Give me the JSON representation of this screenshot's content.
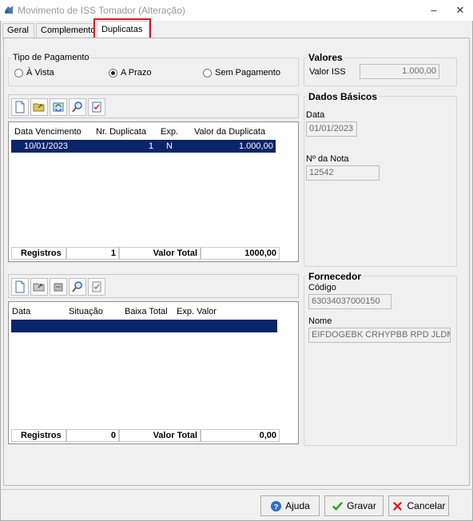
{
  "window": {
    "title": "Movimento de ISS Tomador (Alteração)",
    "controls": {
      "minimize": "–",
      "close": "✕"
    }
  },
  "tabs": [
    {
      "label": "Geral"
    },
    {
      "label": "Complemento"
    },
    {
      "label": "Duplicatas",
      "active": true
    }
  ],
  "tipo_pagamento": {
    "title": "Tipo de Pagamento",
    "options": [
      {
        "label": "À Vista",
        "selected": false
      },
      {
        "label": "A Prazo",
        "selected": true
      },
      {
        "label": "Sem Pagamento",
        "selected": false
      }
    ]
  },
  "valores": {
    "title": "Valores",
    "iss_label": "Valor ISS",
    "iss_value": "1.000,00"
  },
  "dados_basicos": {
    "title": "Dados Básicos",
    "data_label": "Data",
    "data_value": "01/01/2023",
    "nota_label": "Nº da Nota",
    "nota_value": "12542"
  },
  "fornecedor": {
    "title": "Fornecedor",
    "codigo_label": "Código",
    "codigo_value": "63034037000150",
    "nome_label": "Nome",
    "nome_value": "EIFDOGEBK CRHYPBB RPD JLDM"
  },
  "duplicatas_grid": {
    "columns": [
      "Data Vencimento",
      "Nr. Duplicata",
      "Exp.",
      "Valor da Duplicata"
    ],
    "rows": [
      {
        "data": "10/01/2023",
        "nr": "1",
        "exp": "N",
        "valor": "1.000,00"
      }
    ],
    "footer": {
      "registros_label": "Registros",
      "registros": "1",
      "total_label": "Valor Total",
      "total": "1000,00"
    }
  },
  "baixas_grid": {
    "columns": [
      "Data",
      "Situação",
      "Baixa Total",
      "Exp. Valor"
    ],
    "footer": {
      "registros_label": "Registros",
      "registros": "0",
      "total_label": "Valor Total",
      "total": "0,00"
    }
  },
  "buttons": {
    "ajuda": "Ajuda",
    "gravar": "Gravar",
    "cancelar": "Cancelar"
  },
  "colors": {
    "selection": "#0a246a",
    "tab_highlight": "#e0141e"
  }
}
